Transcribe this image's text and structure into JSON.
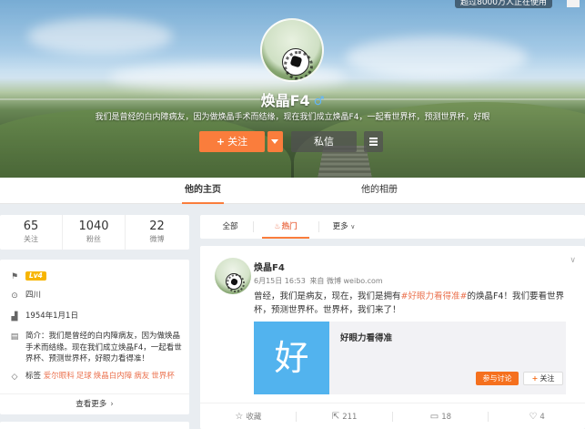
{
  "header": {
    "top_badge": "超过8000万人正在使用",
    "name": "焕晶F4",
    "gender_icon": "♂",
    "bio": "我们是曾经的白内障病友，因为做焕晶手术而结缘，现在我们成立焕晶F4，一起看世界杯，预测世界杯，好眼",
    "follow_label": "关注",
    "follow_plus": "+",
    "message_label": "私信"
  },
  "tabs": {
    "home": "他的主页",
    "album": "他的相册"
  },
  "stats": [
    {
      "value": "65",
      "label": "关注"
    },
    {
      "value": "1040",
      "label": "粉丝"
    },
    {
      "value": "22",
      "label": "微博"
    }
  ],
  "info": {
    "level": "Lv4",
    "location": "四川",
    "birthday": "1954年1月1日",
    "intro": "简介：我们是曾经的白内障病友，因为做焕晶手术而结缘。现在我们成立焕晶F4，一起看世界杯、预测世界杯，好眼力看得准！",
    "tags_label": "标签",
    "tags": [
      "爱尔眼科",
      "足球",
      "焕晶白内障",
      "病友",
      "世界杯"
    ],
    "see_more": "查看更多",
    "see_more_chev": "›"
  },
  "filter": {
    "all": "全部",
    "hot": "热门",
    "more": "更多",
    "more_chev": "∨"
  },
  "post": {
    "author": "焕晶F4",
    "time": "6月15日 16:53",
    "from": "来自 微博 weibo.com",
    "text_pre": "曾经，我们是病友，现在，我们是拥有",
    "topic": "#好眼力看得准#",
    "text_post": "的焕晶F4！我们要看世界杯，预测世界杯。世界杯，我们来了！",
    "embed": {
      "thumb_char": "好",
      "title": "好眼力看得准",
      "join_label": "参与讨论",
      "follow_label": "关注",
      "follow_plus": "+"
    },
    "actions": {
      "favorite": "收藏",
      "repost": "211",
      "comment": "18",
      "like": "4"
    }
  },
  "colors": {
    "accent": "#fa7d3c",
    "link": "#eb7350",
    "topic_blue": "#52b3ee"
  }
}
